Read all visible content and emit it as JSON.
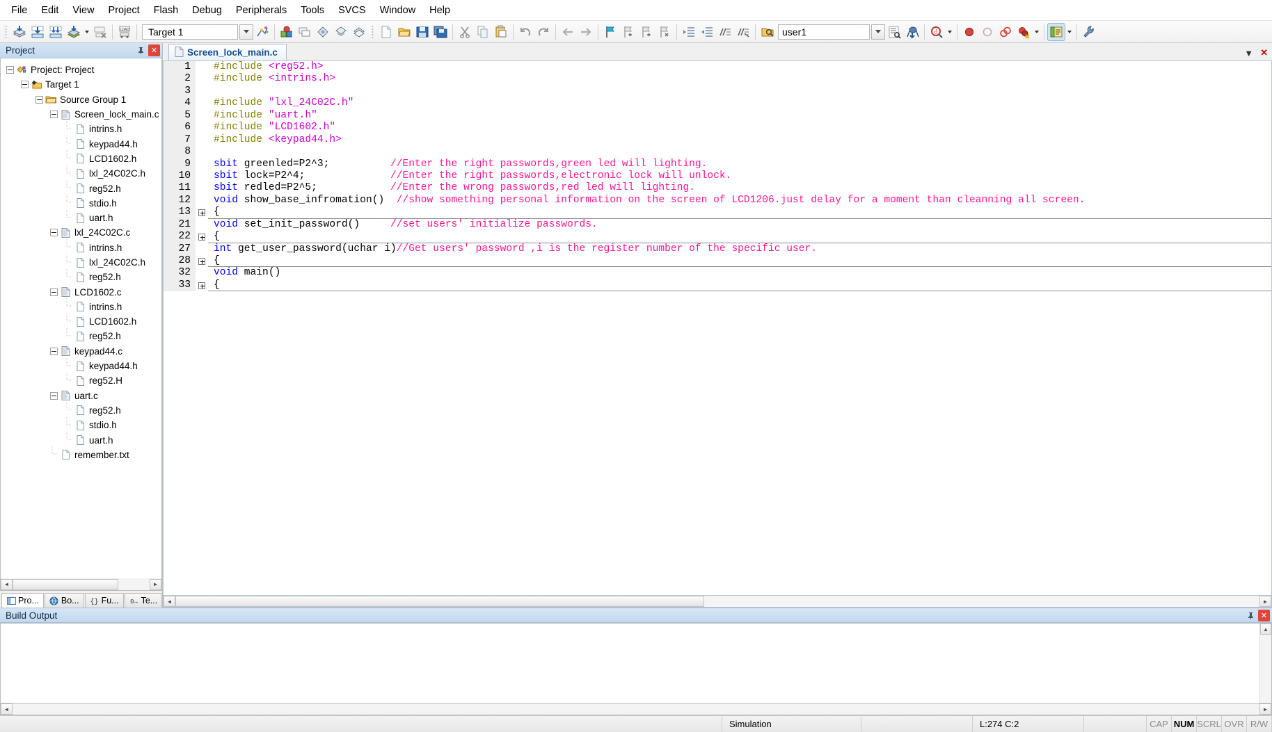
{
  "menubar": {
    "items": [
      {
        "label": "File"
      },
      {
        "label": "Edit"
      },
      {
        "label": "View"
      },
      {
        "label": "Project"
      },
      {
        "label": "Flash"
      },
      {
        "label": "Debug"
      },
      {
        "label": "Peripherals"
      },
      {
        "label": "Tools"
      },
      {
        "label": "SVCS"
      },
      {
        "label": "Window"
      },
      {
        "label": "Help"
      }
    ]
  },
  "toolbar": {
    "target_value": "Target 1",
    "find_value": "user1",
    "buttons": [
      {
        "name": "translate-icon",
        "title": "Translate"
      },
      {
        "name": "build-icon",
        "title": "Build"
      },
      {
        "name": "rebuild-icon",
        "title": "Rebuild"
      },
      {
        "name": "batch-build-icon",
        "title": "Batch Build"
      },
      {
        "name": "stop-build-icon",
        "title": "Stop Build"
      },
      {
        "name": "download-icon",
        "title": "Download"
      },
      {
        "name": "target-options-icon",
        "title": "Options for Target"
      },
      {
        "name": "manage-components-icon",
        "title": "Manage Components"
      },
      {
        "name": "new-file-icon",
        "title": "New"
      },
      {
        "name": "open-file-icon",
        "title": "Open"
      },
      {
        "name": "save-icon",
        "title": "Save"
      },
      {
        "name": "save-all-icon",
        "title": "Save All"
      },
      {
        "name": "cut-icon",
        "title": "Cut"
      },
      {
        "name": "copy-icon",
        "title": "Copy"
      },
      {
        "name": "paste-icon",
        "title": "Paste"
      },
      {
        "name": "undo-icon",
        "title": "Undo"
      },
      {
        "name": "redo-icon",
        "title": "Redo"
      },
      {
        "name": "navigate-back-icon",
        "title": "Back"
      },
      {
        "name": "navigate-forward-icon",
        "title": "Forward"
      },
      {
        "name": "toggle-bookmark-icon",
        "title": "Insert/Remove Bookmark"
      },
      {
        "name": "previous-bookmark-icon",
        "title": "Previous Bookmark"
      },
      {
        "name": "next-bookmark-icon",
        "title": "Next Bookmark"
      },
      {
        "name": "clear-bookmarks-icon",
        "title": "Clear All Bookmarks"
      },
      {
        "name": "indent-icon",
        "title": "Indent"
      },
      {
        "name": "outdent-icon",
        "title": "Outdent"
      },
      {
        "name": "comment-icon",
        "title": "Comment"
      },
      {
        "name": "uncomment-icon",
        "title": "Uncomment"
      },
      {
        "name": "find-in-files-icon",
        "title": "Find in Files"
      },
      {
        "name": "bookmark-list-icon",
        "title": "Bookmarks"
      },
      {
        "name": "debug-session-icon",
        "title": "Start/Stop Debug Session"
      },
      {
        "name": "search-icon",
        "title": "Find"
      },
      {
        "name": "insert-breakpoint-icon",
        "title": "Insert/Remove Breakpoint"
      },
      {
        "name": "enable-breakpoint-icon",
        "title": "Enable/Disable Breakpoint"
      },
      {
        "name": "disable-all-breakpoints-icon",
        "title": "Disable All Breakpoints"
      },
      {
        "name": "kill-all-breakpoints-icon",
        "title": "Kill All Breakpoints"
      },
      {
        "name": "project-window-icon",
        "title": "Project Window"
      },
      {
        "name": "configuration-icon",
        "title": "Configuration"
      }
    ]
  },
  "project_pane": {
    "title": "Project",
    "tree": [
      {
        "depth": 0,
        "label": "Project: Project",
        "icon": "project-icon",
        "expander": "expanded"
      },
      {
        "depth": 1,
        "label": "Target 1",
        "icon": "target-icon",
        "expander": "expanded"
      },
      {
        "depth": 2,
        "label": "Source Group 1",
        "icon": "folder-icon",
        "expander": "expanded"
      },
      {
        "depth": 3,
        "label": "Screen_lock_main.c",
        "icon": "c-source-icon",
        "expander": "expanded"
      },
      {
        "depth": 4,
        "label": "intrins.h",
        "icon": "header-icon",
        "expander": "none"
      },
      {
        "depth": 4,
        "label": "keypad44.h",
        "icon": "header-icon",
        "expander": "none"
      },
      {
        "depth": 4,
        "label": "LCD1602.h",
        "icon": "header-icon",
        "expander": "none"
      },
      {
        "depth": 4,
        "label": "lxl_24C02C.h",
        "icon": "header-icon",
        "expander": "none"
      },
      {
        "depth": 4,
        "label": "reg52.h",
        "icon": "header-icon",
        "expander": "none"
      },
      {
        "depth": 4,
        "label": "stdio.h",
        "icon": "header-icon",
        "expander": "none"
      },
      {
        "depth": 4,
        "label": "uart.h",
        "icon": "header-icon",
        "expander": "none"
      },
      {
        "depth": 3,
        "label": "lxl_24C02C.c",
        "icon": "c-source-icon",
        "expander": "expanded"
      },
      {
        "depth": 4,
        "label": "intrins.h",
        "icon": "header-icon",
        "expander": "none"
      },
      {
        "depth": 4,
        "label": "lxl_24C02C.h",
        "icon": "header-icon",
        "expander": "none"
      },
      {
        "depth": 4,
        "label": "reg52.h",
        "icon": "header-icon",
        "expander": "none"
      },
      {
        "depth": 3,
        "label": "LCD1602.c",
        "icon": "c-source-icon",
        "expander": "expanded"
      },
      {
        "depth": 4,
        "label": "intrins.h",
        "icon": "header-icon",
        "expander": "none"
      },
      {
        "depth": 4,
        "label": "LCD1602.h",
        "icon": "header-icon",
        "expander": "none"
      },
      {
        "depth": 4,
        "label": "reg52.h",
        "icon": "header-icon",
        "expander": "none"
      },
      {
        "depth": 3,
        "label": "keypad44.c",
        "icon": "c-source-icon",
        "expander": "expanded"
      },
      {
        "depth": 4,
        "label": "keypad44.h",
        "icon": "header-icon",
        "expander": "none"
      },
      {
        "depth": 4,
        "label": "reg52.H",
        "icon": "header-icon",
        "expander": "none"
      },
      {
        "depth": 3,
        "label": "uart.c",
        "icon": "c-source-icon",
        "expander": "expanded"
      },
      {
        "depth": 4,
        "label": "reg52.h",
        "icon": "header-icon",
        "expander": "none"
      },
      {
        "depth": 4,
        "label": "stdio.h",
        "icon": "header-icon",
        "expander": "none"
      },
      {
        "depth": 4,
        "label": "uart.h",
        "icon": "header-icon",
        "expander": "none"
      },
      {
        "depth": 3,
        "label": "remember.txt",
        "icon": "text-file-icon",
        "expander": "none"
      }
    ],
    "tabs": [
      {
        "label": "Pro...",
        "icon": "project-tab-icon",
        "selected": true
      },
      {
        "label": "Bo...",
        "icon": "books-tab-icon",
        "selected": false
      },
      {
        "label": "Fu...",
        "icon": "functions-tab-icon",
        "selected": false
      },
      {
        "label": "Te...",
        "icon": "templates-tab-icon",
        "selected": false
      }
    ]
  },
  "editor": {
    "tab_label": "Screen_lock_main.c",
    "tab_icon": "c-source-icon",
    "minimize_glyph": "▼",
    "close_glyph": "✕",
    "lines": [
      {
        "num": "1",
        "fold": false,
        "rule": false,
        "parts": [
          {
            "t": "#include ",
            "c": "pre"
          },
          {
            "t": "<reg52.h>",
            "c": "str"
          }
        ]
      },
      {
        "num": "2",
        "fold": false,
        "rule": false,
        "parts": [
          {
            "t": "#include ",
            "c": "pre"
          },
          {
            "t": "<intrins.h>",
            "c": "str"
          }
        ]
      },
      {
        "num": "3",
        "fold": false,
        "rule": false,
        "parts": []
      },
      {
        "num": "4",
        "fold": false,
        "rule": false,
        "parts": [
          {
            "t": "#include ",
            "c": "pre"
          },
          {
            "t": "\"lxl_24C02C.h\"",
            "c": "str"
          }
        ]
      },
      {
        "num": "5",
        "fold": false,
        "rule": false,
        "parts": [
          {
            "t": "#include ",
            "c": "pre"
          },
          {
            "t": "\"uart.h\"",
            "c": "str"
          }
        ]
      },
      {
        "num": "6",
        "fold": false,
        "rule": false,
        "parts": [
          {
            "t": "#include ",
            "c": "pre"
          },
          {
            "t": "\"LCD1602.h\"",
            "c": "str"
          }
        ]
      },
      {
        "num": "7",
        "fold": false,
        "rule": false,
        "parts": [
          {
            "t": "#include ",
            "c": "pre"
          },
          {
            "t": "<keypad44.h>",
            "c": "str"
          }
        ]
      },
      {
        "num": "8",
        "fold": false,
        "rule": false,
        "parts": []
      },
      {
        "num": "9",
        "fold": false,
        "rule": false,
        "parts": [
          {
            "t": "sbit",
            "c": "kw"
          },
          {
            "t": " greenled=P2^3;          ",
            "c": "plain"
          },
          {
            "t": "//Enter the right passwords,green led will lighting.",
            "c": "cmt"
          }
        ]
      },
      {
        "num": "10",
        "fold": false,
        "rule": false,
        "parts": [
          {
            "t": "sbit",
            "c": "kw"
          },
          {
            "t": " lock=P2^4;              ",
            "c": "plain"
          },
          {
            "t": "//Enter the right passwords,electronic lock will unlock.",
            "c": "cmt"
          }
        ]
      },
      {
        "num": "11",
        "fold": false,
        "rule": false,
        "parts": [
          {
            "t": "sbit",
            "c": "kw"
          },
          {
            "t": " redled=P2^5;            ",
            "c": "plain"
          },
          {
            "t": "//Enter the wrong passwords,red led will lighting.",
            "c": "cmt"
          }
        ]
      },
      {
        "num": "12",
        "fold": false,
        "rule": false,
        "parts": [
          {
            "t": "void",
            "c": "kw"
          },
          {
            "t": " show_base_infromation()  ",
            "c": "plain"
          },
          {
            "t": "//show something personal information on the screen of LCD1206.just delay for a moment than cleanning all screen.",
            "c": "cmt"
          }
        ]
      },
      {
        "num": "13",
        "fold": true,
        "rule": true,
        "parts": [
          {
            "t": "{",
            "c": "plain"
          }
        ]
      },
      {
        "num": "21",
        "fold": false,
        "rule": false,
        "parts": [
          {
            "t": "void",
            "c": "kw"
          },
          {
            "t": " set_init_password()     ",
            "c": "plain"
          },
          {
            "t": "//set users' initialize passwords.",
            "c": "cmt"
          }
        ]
      },
      {
        "num": "22",
        "fold": true,
        "rule": true,
        "parts": [
          {
            "t": "{",
            "c": "plain"
          }
        ]
      },
      {
        "num": "27",
        "fold": false,
        "rule": false,
        "parts": [
          {
            "t": "int",
            "c": "kw"
          },
          {
            "t": " get_user_password(uchar i)",
            "c": "plain"
          },
          {
            "t": "//Get users' password ,i is the register number of the specific user.",
            "c": "cmt"
          }
        ]
      },
      {
        "num": "28",
        "fold": true,
        "rule": true,
        "parts": [
          {
            "t": "{",
            "c": "plain"
          }
        ]
      },
      {
        "num": "32",
        "fold": false,
        "rule": false,
        "parts": [
          {
            "t": "void",
            "c": "kw"
          },
          {
            "t": " main()",
            "c": "plain"
          }
        ]
      },
      {
        "num": "33",
        "fold": true,
        "rule": true,
        "parts": [
          {
            "t": "{",
            "c": "plain"
          }
        ]
      }
    ]
  },
  "build_output": {
    "title": "Build Output",
    "content": ""
  },
  "statusbar": {
    "message": "",
    "simulation": "Simulation",
    "cursor": "L:274 C:2",
    "indicators": [
      {
        "label": "CAP",
        "active": false
      },
      {
        "label": "NUM",
        "active": true
      },
      {
        "label": "SCRL",
        "active": false
      },
      {
        "label": "OVR",
        "active": false
      },
      {
        "label": "R/W",
        "active": false
      }
    ]
  },
  "colors": {
    "keyword": "#0000ff",
    "preprocessor": "#808000",
    "string": "#cc00cc",
    "comment": "#ff1493",
    "pane_title_bg": "#c3d8ee",
    "close_button": "#e0453a"
  }
}
